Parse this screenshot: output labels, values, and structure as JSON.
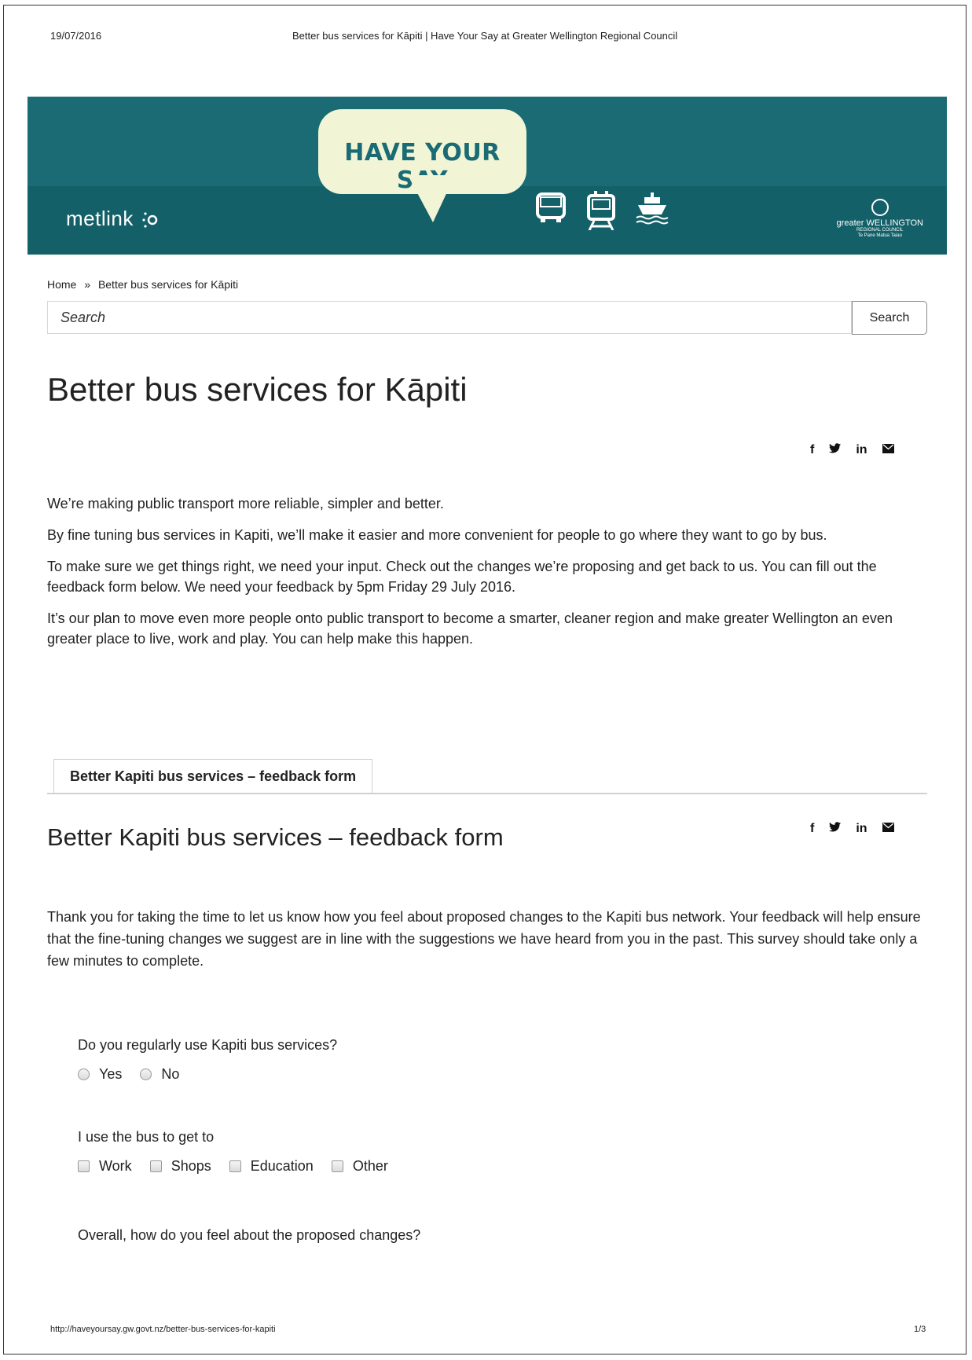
{
  "print_header": {
    "date": "19/07/2016",
    "title": "Better bus services for Kāpiti | Have Your Say at Greater Wellington Regional Council"
  },
  "banner": {
    "left_logo": "metlink",
    "bubble_text": "HAVE YOUR SAY",
    "right_logo_line1": "greater WELLINGTON",
    "right_logo_line2": "REGIONAL COUNCIL",
    "right_logo_line3": "Te Pane Matua Taiao",
    "icons": [
      "bus-icon",
      "train-icon",
      "ferry-icon"
    ],
    "colors": {
      "teal": "#1a6b74",
      "bubble": "#f1f5d6"
    }
  },
  "breadcrumb": {
    "home": "Home",
    "separator": "»",
    "current": "Better bus services for Kāpiti"
  },
  "search": {
    "placeholder": "Search",
    "button_label": "Search"
  },
  "page": {
    "title": "Better bus services for Kāpiti",
    "intro": [
      "We’re making public transport more reliable, simpler and better.",
      "By fine tuning bus services in Kapiti, we’ll make it easier and more convenient for people to go where they want to go by bus.",
      "To make sure we get things right, we need your input. Check out the changes we’re proposing and get back to us. You can fill out the feedback form below. We need your feedback by 5pm Friday 29 July 2016.",
      "It’s our plan to move even more people onto public transport to become a smarter, cleaner region and make greater Wellington an even greater place to live, work and play. You can help make this happen."
    ]
  },
  "share": {
    "facebook": "f",
    "twitter": "🐦",
    "linkedin": "in"
  },
  "tabs": [
    {
      "label": "Better Kapiti bus services – feedback form"
    }
  ],
  "form": {
    "title": "Better Kapiti bus services – feedback form",
    "intro": "Thank you for taking the time to let us know how you feel about proposed changes to the Kapiti bus network. Your feedback will help ensure that the fine-tuning changes we suggest are in line with the suggestions we have heard from you in the past. This survey should take only a few minutes to complete.",
    "q1": {
      "label": "Do you regularly use Kapiti bus services?",
      "options": [
        "Yes",
        "No"
      ]
    },
    "q2": {
      "label": "I use the bus to get to",
      "options": [
        "Work",
        "Shops",
        "Education",
        "Other"
      ]
    },
    "q3": {
      "label": "Overall, how do you feel about the proposed changes?"
    }
  },
  "print_footer": {
    "url": "http://haveyoursay.gw.govt.nz/better-bus-services-for-kapiti",
    "page": "1/3"
  }
}
